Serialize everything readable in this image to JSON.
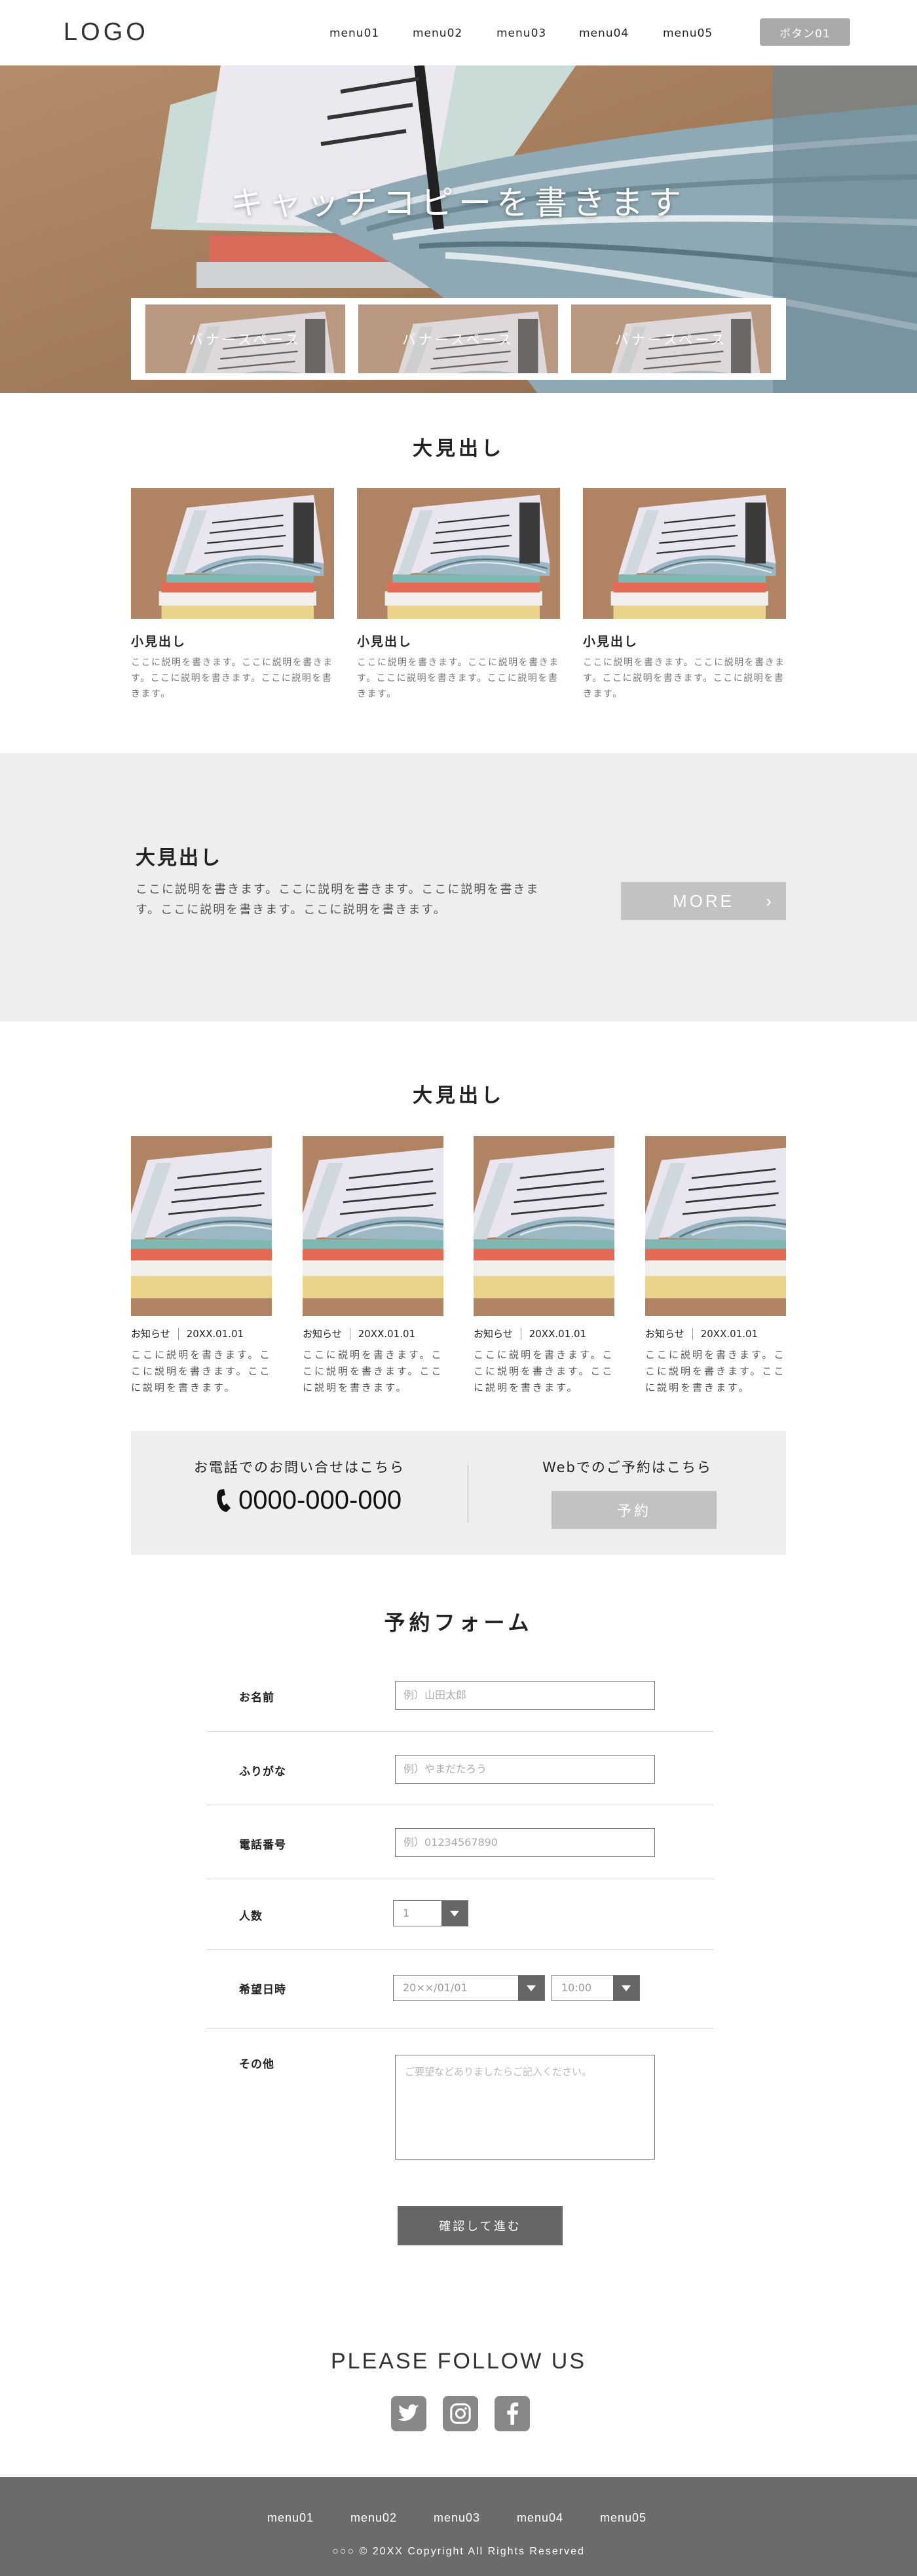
{
  "header": {
    "logo": "LOGO",
    "nav": [
      "menu01",
      "menu02",
      "menu03",
      "menu04",
      "menu05"
    ],
    "button": "ボタン01"
  },
  "hero": {
    "catch_copy": "キャッチコピーを書きます",
    "banners": [
      "バナースペース",
      "バナースペース",
      "バナースペース"
    ]
  },
  "section1": {
    "heading": "大見出し",
    "cards": [
      {
        "title": "小見出し",
        "text": "ここに説明を書きます。ここに説明を書きます。ここに説明を書きます。ここに説明を書きます。"
      },
      {
        "title": "小見出し",
        "text": "ここに説明を書きます。ここに説明を書きます。ここに説明を書きます。ここに説明を書きます。"
      },
      {
        "title": "小見出し",
        "text": "ここに説明を書きます。ここに説明を書きます。ここに説明を書きます。ここに説明を書きます。"
      }
    ]
  },
  "band": {
    "heading": "大見出し",
    "text": "ここに説明を書きます。ここに説明を書きます。ここに説明を書きます。ここに説明を書きます。ここに説明を書きます。",
    "more": "MORE"
  },
  "news": {
    "heading": "大見出し",
    "items": [
      {
        "category": "お知らせ",
        "date": "20XX.01.01",
        "text": "ここに説明を書きます。ここに説明を書きます。ここに説明を書きます。"
      },
      {
        "category": "お知らせ",
        "date": "20XX.01.01",
        "text": "ここに説明を書きます。ここに説明を書きます。ここに説明を書きます。"
      },
      {
        "category": "お知らせ",
        "date": "20XX.01.01",
        "text": "ここに説明を書きます。ここに説明を書きます。ここに説明を書きます。"
      },
      {
        "category": "お知らせ",
        "date": "20XX.01.01",
        "text": "ここに説明を書きます。ここに説明を書きます。ここに説明を書きます。"
      }
    ]
  },
  "contact": {
    "phone_label": "お電話でのお問い合せはこちら",
    "phone_number": "0000-000-000",
    "web_label": "Webでのご予約はこちら",
    "reserve_button": "予約"
  },
  "form": {
    "title": "予約フォーム",
    "name_label": "お名前",
    "name_placeholder": "例）山田太郎",
    "kana_label": "ふりがな",
    "kana_placeholder": "例）やまだたろう",
    "tel_label": "電話番号",
    "tel_placeholder": "例）01234567890",
    "people_label": "人数",
    "people_value": "1",
    "date_label": "希望日時",
    "date_value": "20××/01/01",
    "time_value": "10:00",
    "other_label": "その他",
    "other_placeholder": "ご要望などありましたらご記入ください。",
    "confirm_button": "確認して進む"
  },
  "follow": {
    "title": "PLEASE FOLLOW US",
    "icons": [
      "twitter-icon",
      "instagram-icon",
      "facebook-icon"
    ]
  },
  "footer": {
    "nav": [
      "menu01",
      "menu02",
      "menu03",
      "menu04",
      "menu05"
    ],
    "copyright": "○○○ © 20XX Copyright All Rights Reserved"
  },
  "colors": {
    "button_grey": "#aaaaaa",
    "band_bg": "#eeeeee",
    "dark_button": "#666666",
    "footer_bg": "#6b6b6b"
  }
}
